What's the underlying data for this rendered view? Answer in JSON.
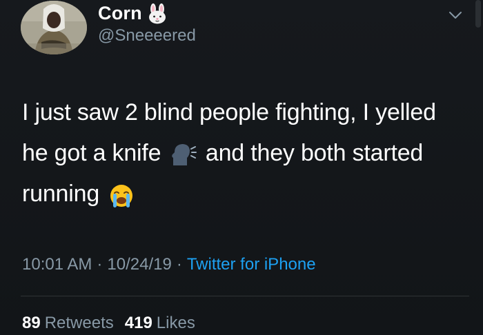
{
  "user": {
    "display_name": "Corn",
    "handle": "@Sneeeered",
    "name_emoji": "rabbit-face-emoji"
  },
  "tweet": {
    "segments": [
      "I just saw 2 blind people fighting, I yelled he got a knife",
      "and they both started running"
    ],
    "emojis": [
      "speaking-head-emoji",
      "loudly-crying-face-emoji"
    ]
  },
  "meta": {
    "time": "10:01 AM",
    "separator": "·",
    "date": "10/24/19",
    "source": "Twitter for iPhone"
  },
  "stats": {
    "retweets_count": "89",
    "retweets_label": "Retweets",
    "likes_count": "419",
    "likes_label": "Likes"
  },
  "colors": {
    "background": "#15181c",
    "secondary_text": "#8899a6",
    "link": "#1da1f2"
  }
}
